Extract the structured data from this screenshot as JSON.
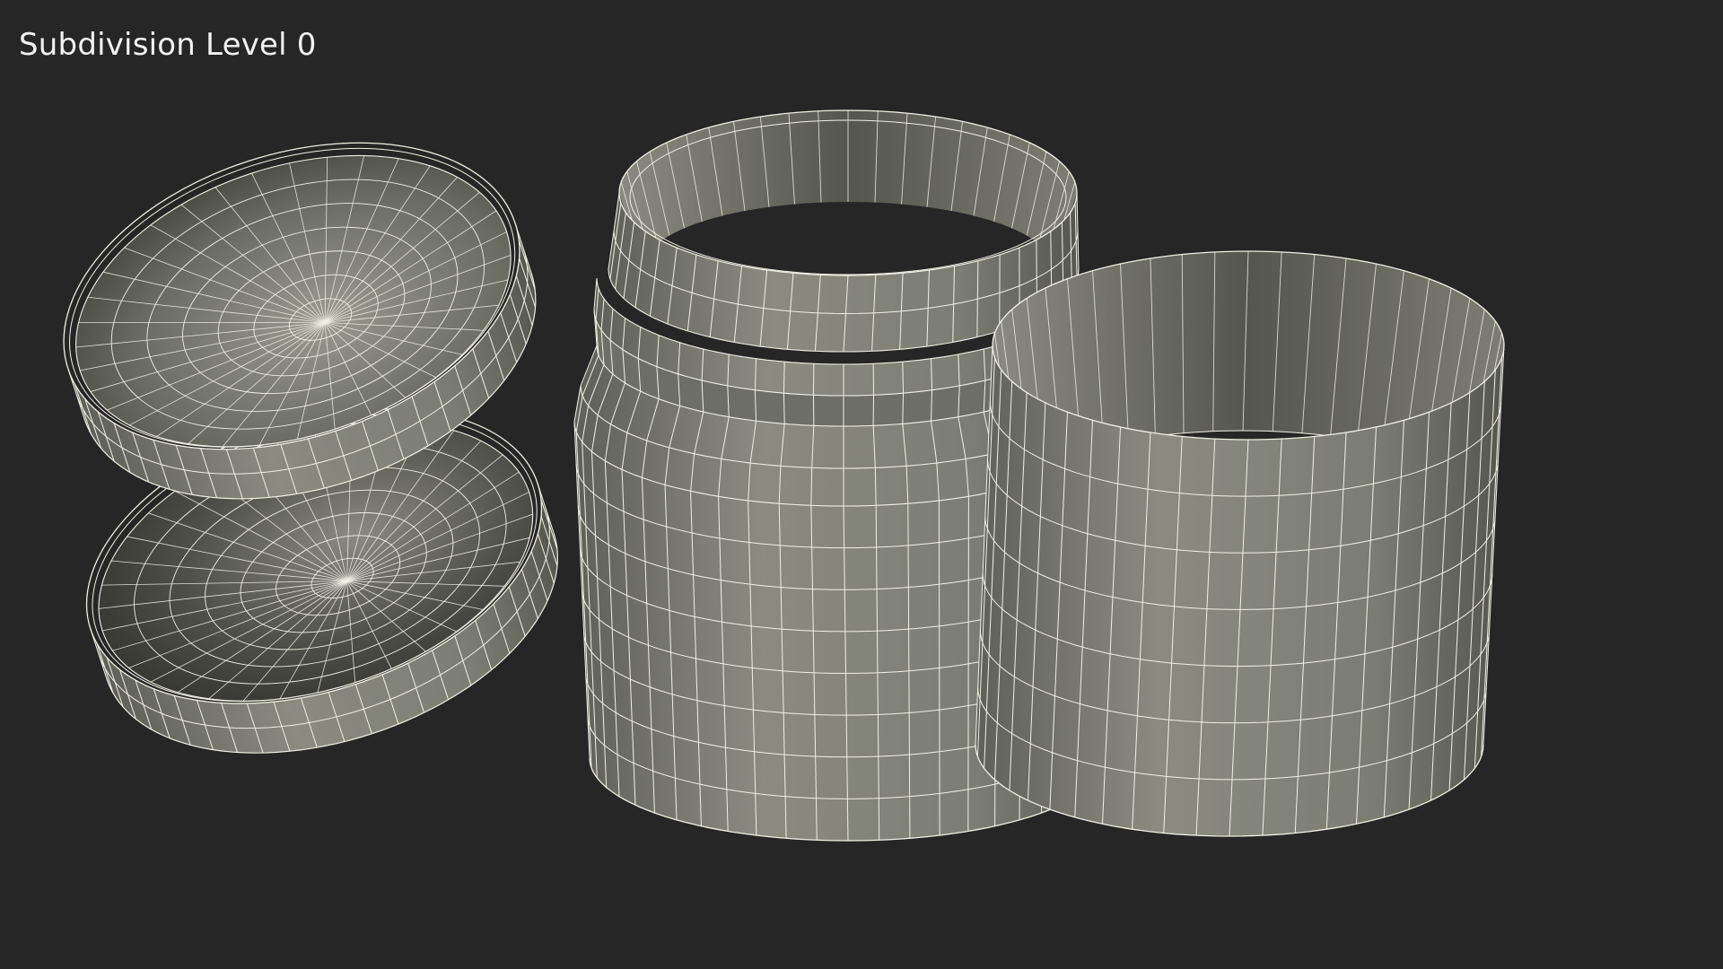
{
  "caption": "Subdivision Level 0",
  "colors": {
    "background": "#262626",
    "wire": "#f1f0e4",
    "surface_light": "#8f8f84",
    "surface_dark": "#4a4b42",
    "interior_dark": "#35362f",
    "caption": "#f2f2f2"
  },
  "objects": [
    {
      "name": "jar-lid-upper",
      "kind": "lid"
    },
    {
      "name": "jar-lid-lower",
      "kind": "lid"
    },
    {
      "name": "jar-body",
      "kind": "jar"
    },
    {
      "name": "jar-label-sleeve",
      "kind": "sleeve"
    }
  ]
}
